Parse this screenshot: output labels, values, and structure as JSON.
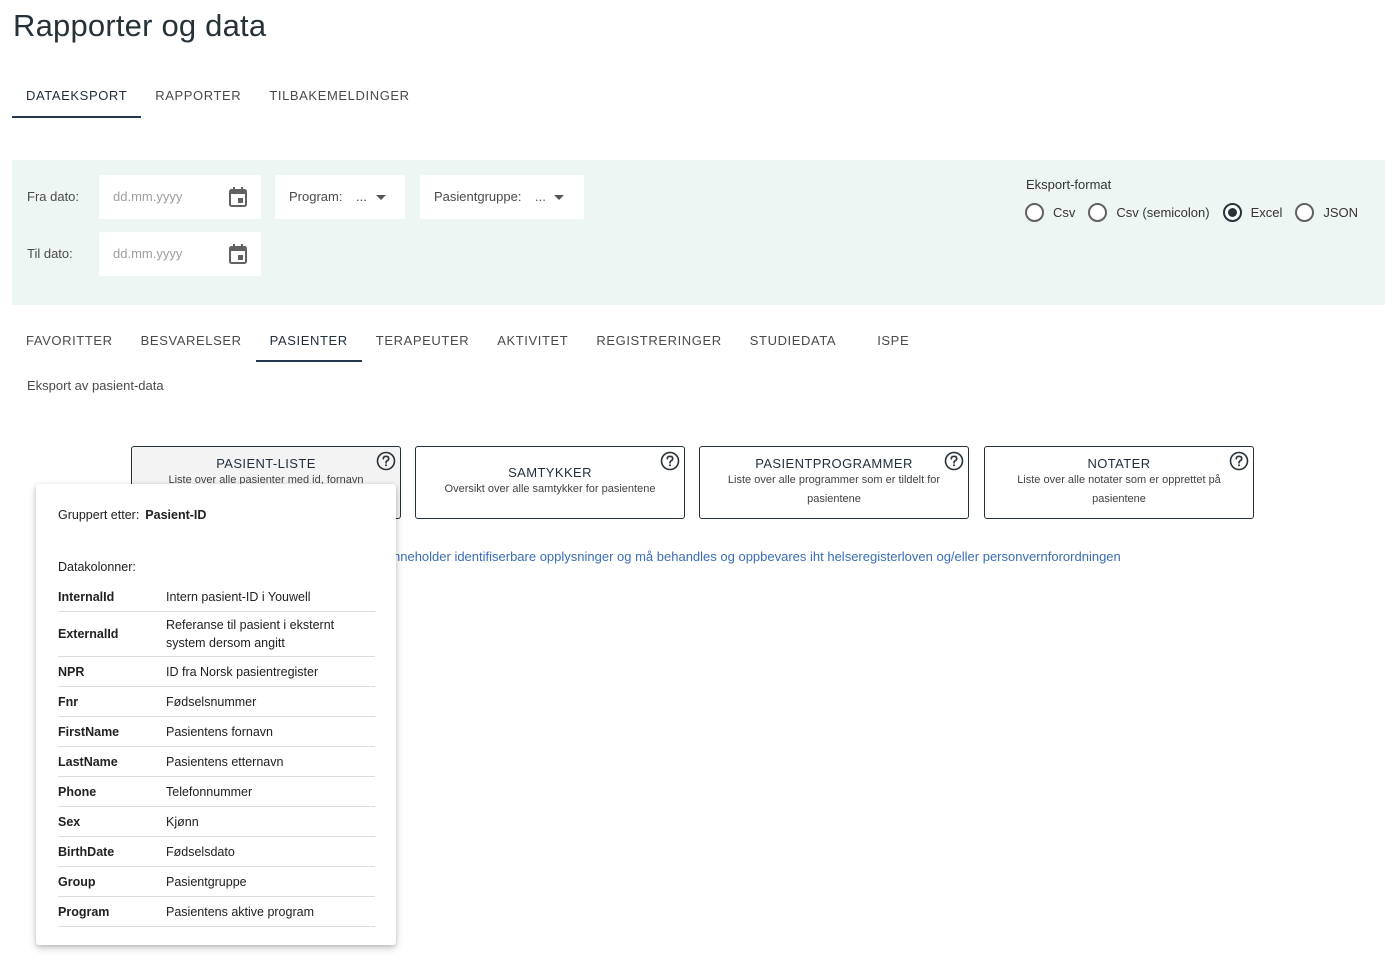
{
  "page": {
    "title": "Rapporter og data"
  },
  "main_tabs": [
    {
      "label": "DATAEKSPORT",
      "active": true
    },
    {
      "label": "RAPPORTER",
      "active": false
    },
    {
      "label": "TILBAKEMELDINGER",
      "active": false
    }
  ],
  "filters": {
    "from_label": "Fra dato:",
    "to_label": "Til dato:",
    "date_placeholder": "dd.mm.yyyy",
    "program_label": "Program:",
    "program_value": "...",
    "group_label": "Pasientgruppe:",
    "group_value": "..."
  },
  "export_format": {
    "title": "Eksport-format",
    "options": [
      {
        "label": "Csv",
        "checked": false
      },
      {
        "label": "Csv (semicolon)",
        "checked": false
      },
      {
        "label": "Excel",
        "checked": true
      },
      {
        "label": "JSON",
        "checked": false
      }
    ]
  },
  "sub_tabs": [
    {
      "label": "FAVORITTER",
      "active": false
    },
    {
      "label": "BESVARELSER",
      "active": false
    },
    {
      "label": "PASIENTER",
      "active": true
    },
    {
      "label": "TERAPEUTER",
      "active": false
    },
    {
      "label": "AKTIVITET",
      "active": false
    },
    {
      "label": "REGISTRERINGER",
      "active": false
    },
    {
      "label": "STUDIEDATA",
      "active": false
    },
    {
      "label": "ISPE",
      "active": false
    }
  ],
  "section": {
    "description": "Eksport av pasient-data"
  },
  "cards": [
    {
      "title": "PASIENT-LISTE",
      "description": "Liste over alle pasienter med id, fornavn"
    },
    {
      "title": "SAMTYKKER",
      "description": "Oversikt over alle samtykker for pasientene"
    },
    {
      "title": "PASIENTPROGRAMMER",
      "description": "Liste over alle programmer som er tildelt for pasientene"
    },
    {
      "title": "NOTATER",
      "description": "Liste over alle notater som er opprettet på pasientene"
    }
  ],
  "warning": "nneholder identifiserbare opplysninger og må behandles og oppbevares iht helseregisterloven og/eller personvernforordningen",
  "popover": {
    "grouped_by_label": "Gruppert etter:",
    "grouped_by_value": "Pasient-ID",
    "columns_label": "Datakolonner:",
    "columns": [
      {
        "name": "InternalId",
        "description": "Intern pasient-ID i Youwell"
      },
      {
        "name": "ExternalId",
        "description": "Referanse til pasient i eksternt system dersom angitt"
      },
      {
        "name": "NPR",
        "description": "ID fra Norsk pasientregister"
      },
      {
        "name": "Fnr",
        "description": "Fødselsnummer"
      },
      {
        "name": "FirstName",
        "description": "Pasientens fornavn"
      },
      {
        "name": "LastName",
        "description": "Pasientens etternavn"
      },
      {
        "name": "Phone",
        "description": "Telefonnummer"
      },
      {
        "name": "Sex",
        "description": "Kjønn"
      },
      {
        "name": "BirthDate",
        "description": "Fødselsdato"
      },
      {
        "name": "Group",
        "description": "Pasientgruppe"
      },
      {
        "name": "Program",
        "description": "Pasientens aktive program"
      }
    ]
  }
}
